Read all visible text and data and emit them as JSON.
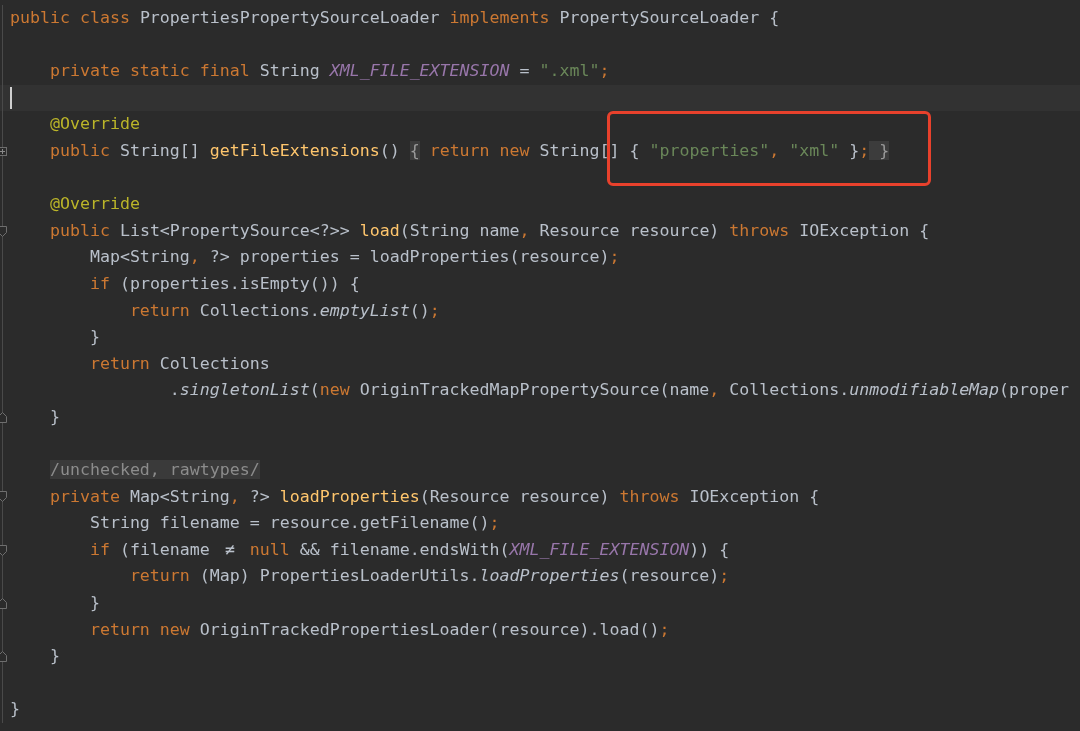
{
  "lines": [
    {
      "tokens": [
        {
          "kind": "keyword",
          "text": "public class "
        },
        {
          "kind": "plain",
          "text": "PropertiesPropertySourceLoader "
        },
        {
          "kind": "keyword",
          "text": "implements "
        },
        {
          "kind": "plain",
          "text": "PropertySourceLoader {"
        }
      ]
    },
    {
      "gap_before": true,
      "tokens": [
        {
          "kind": "keyword",
          "text": "    private static final "
        },
        {
          "kind": "plain",
          "text": "String "
        },
        {
          "kind": "constant",
          "text": "XML_FILE_EXTENSION"
        },
        {
          "kind": "plain",
          "text": " = "
        },
        {
          "kind": "string",
          "text": "\".xml\""
        },
        {
          "kind": "keyword",
          "text": ";"
        }
      ]
    },
    {
      "current": true
    },
    {
      "tokens": [
        {
          "kind": "annotation",
          "text": "    @Override"
        }
      ]
    },
    {
      "collapsed": true,
      "tokens": [
        {
          "kind": "keyword",
          "text": "    public "
        },
        {
          "kind": "plain",
          "text": "String[] "
        },
        {
          "kind": "declaration",
          "text": "getFileExtensions"
        },
        {
          "kind": "plain",
          "text": "() "
        },
        {
          "kind": "folded",
          "text": "{"
        },
        {
          "kind": "keyword",
          "text": " return new "
        },
        {
          "kind": "plain",
          "text": "String["
        }
      ],
      "framed_tokens": [
        {
          "kind": "plain",
          "text": "] { "
        },
        {
          "kind": "string",
          "text": "\"properties\""
        },
        {
          "kind": "keyword",
          "text": ","
        },
        {
          "kind": "string",
          "text": " \"xml\""
        },
        {
          "kind": "plain",
          "text": " }"
        },
        {
          "kind": "keyword",
          "text": ";"
        },
        {
          "kind": "folded",
          "text": " }"
        }
      ]
    },
    {
      "gap_before": true,
      "tokens": [
        {
          "kind": "annotation",
          "text": "    @Override"
        }
      ]
    },
    {
      "fold_start": true,
      "tokens": [
        {
          "kind": "keyword",
          "text": "    public "
        },
        {
          "kind": "plain",
          "text": "List<PropertySource<?>> "
        },
        {
          "kind": "declaration",
          "text": "load"
        },
        {
          "kind": "plain",
          "text": "(String name"
        },
        {
          "kind": "keyword",
          "text": ","
        },
        {
          "kind": "plain",
          "text": " Resource resource) "
        },
        {
          "kind": "keyword",
          "text": "throws "
        },
        {
          "kind": "plain",
          "text": "IOException {"
        }
      ]
    },
    {
      "tokens": [
        {
          "kind": "plain",
          "text": "        Map<String"
        },
        {
          "kind": "keyword",
          "text": ","
        },
        {
          "kind": "plain",
          "text": " ?> properties = loadProperties(resource)"
        },
        {
          "kind": "keyword",
          "text": ";"
        }
      ]
    },
    {
      "tokens": [
        {
          "kind": "keyword",
          "text": "        if "
        },
        {
          "kind": "plain",
          "text": "(properties.isEmpty()) {"
        }
      ]
    },
    {
      "tokens": [
        {
          "kind": "keyword",
          "text": "            return "
        },
        {
          "kind": "plain",
          "text": "Collections."
        },
        {
          "kind": "static",
          "text": "emptyList"
        },
        {
          "kind": "plain",
          "text": "()"
        },
        {
          "kind": "keyword",
          "text": ";"
        }
      ]
    },
    {
      "tokens": [
        {
          "kind": "plain",
          "text": "        }"
        }
      ]
    },
    {
      "tokens": [
        {
          "kind": "keyword",
          "text": "        return "
        },
        {
          "kind": "plain",
          "text": "Collections"
        }
      ]
    },
    {
      "tokens": [
        {
          "kind": "plain",
          "text": "                ."
        },
        {
          "kind": "static",
          "text": "singletonList"
        },
        {
          "kind": "plain",
          "text": "("
        },
        {
          "kind": "keyword",
          "text": "new "
        },
        {
          "kind": "plain",
          "text": "OriginTrackedMapPropertySource(name"
        },
        {
          "kind": "keyword",
          "text": ","
        },
        {
          "kind": "plain",
          "text": " Collections."
        },
        {
          "kind": "static",
          "text": "unmodifiableMap"
        },
        {
          "kind": "plain",
          "text": "(proper"
        }
      ]
    },
    {
      "fold_end": true,
      "tokens": [
        {
          "kind": "plain",
          "text": "    }"
        }
      ]
    },
    {
      "gap_before": true,
      "tokens": [
        {
          "kind": "hint",
          "text": "/unchecked, rawtypes/"
        }
      ]
    },
    {
      "fold_start": true,
      "tokens": [
        {
          "kind": "keyword",
          "text": "    private "
        },
        {
          "kind": "plain",
          "text": "Map<String"
        },
        {
          "kind": "keyword",
          "text": ","
        },
        {
          "kind": "plain",
          "text": " ?> "
        },
        {
          "kind": "declaration",
          "text": "loadProperties"
        },
        {
          "kind": "plain",
          "text": "(Resource resource) "
        },
        {
          "kind": "keyword",
          "text": "throws "
        },
        {
          "kind": "plain",
          "text": "IOException {"
        }
      ]
    },
    {
      "tokens": [
        {
          "kind": "plain",
          "text": "        String filename = resource.getFilename()"
        },
        {
          "kind": "keyword",
          "text": ";"
        }
      ]
    },
    {
      "fold_start": true,
      "tokens": [
        {
          "kind": "keyword",
          "text": "        if "
        },
        {
          "kind": "plain",
          "text": "(filename "
        },
        {
          "kind": "ligature",
          "text": "≠"
        },
        {
          "kind": "keyword",
          "text": " null "
        },
        {
          "kind": "plain",
          "text": "&& filename.endsWith("
        },
        {
          "kind": "constant",
          "text": "XML_FILE_EXTENSION"
        },
        {
          "kind": "plain",
          "text": ")) {"
        }
      ]
    },
    {
      "tokens": [
        {
          "kind": "keyword",
          "text": "            return "
        },
        {
          "kind": "plain",
          "text": "(Map) PropertiesLoaderUtils."
        },
        {
          "kind": "static",
          "text": "loadProperties"
        },
        {
          "kind": "plain",
          "text": "(resource)"
        },
        {
          "kind": "keyword",
          "text": ";"
        }
      ]
    },
    {
      "fold_end": true,
      "tokens": [
        {
          "kind": "plain",
          "text": "        }"
        }
      ]
    },
    {
      "tokens": [
        {
          "kind": "keyword",
          "text": "        return new "
        },
        {
          "kind": "plain",
          "text": "OriginTrackedPropertiesLoader(resource).load()"
        },
        {
          "kind": "keyword",
          "text": ";"
        }
      ]
    },
    {
      "fold_end": true,
      "tokens": [
        {
          "kind": "plain",
          "text": "    }"
        }
      ]
    },
    {
      "gap_before": true,
      "tokens": [
        {
          "kind": "plain",
          "text": "}"
        }
      ]
    }
  ]
}
